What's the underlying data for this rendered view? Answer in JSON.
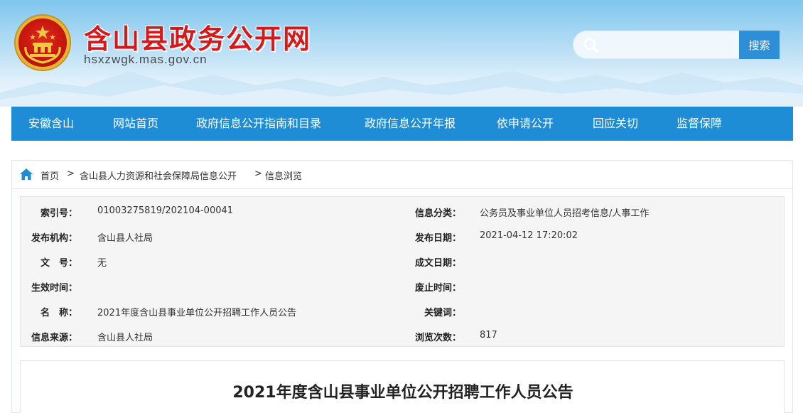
{
  "header": {
    "site_title": "含山县政务公开网",
    "site_url": "hsxzwgk.mas.gov.cn",
    "search_placeholder": "",
    "search_button": "搜索"
  },
  "nav": {
    "items": [
      {
        "label": "安徽含山"
      },
      {
        "label": "网站首页"
      },
      {
        "label": "政府信息公开指南和目录"
      },
      {
        "label": "政府信息公开年报"
      },
      {
        "label": "依申请公开"
      },
      {
        "label": "回应关切"
      },
      {
        "label": "监督保障"
      }
    ]
  },
  "breadcrumb": {
    "items": [
      "首页",
      "含山县人力资源和社会保障局信息公开",
      "信息浏览"
    ],
    "separator": ">"
  },
  "meta": {
    "index_label": "索引号：",
    "index_value": "01003275819/202104-00041",
    "category_label": "信息分类：",
    "category_value": "公务员及事业单位人员招考信息/人事工作",
    "org_label": "发布机构：",
    "org_value": "含山县人社局",
    "publish_date_label": "发布日期：",
    "publish_date_value": "2021-04-12 17:20:02",
    "doc_no_label": "文　号：",
    "doc_no_value": "无",
    "created_date_label": "成文日期：",
    "created_date_value": "",
    "effective_label": "生效时间：",
    "effective_value": "",
    "expiry_label": "废止时间：",
    "expiry_value": "",
    "name_label": "名　称：",
    "name_value": "2021年度含山县事业单位公开招聘工作人员公告",
    "keywords_label": "关键词：",
    "keywords_value": "",
    "source_label": "信息来源：",
    "source_value": "含山县人社局",
    "views_label": "浏览次数：",
    "views_value": "817"
  },
  "article": {
    "title": "2021年度含山县事业单位公开招聘工作人员公告"
  },
  "colors": {
    "nav_bg": "#1f8dd6",
    "title_red": "#d3191a",
    "search_button": "#2e8ed6"
  }
}
